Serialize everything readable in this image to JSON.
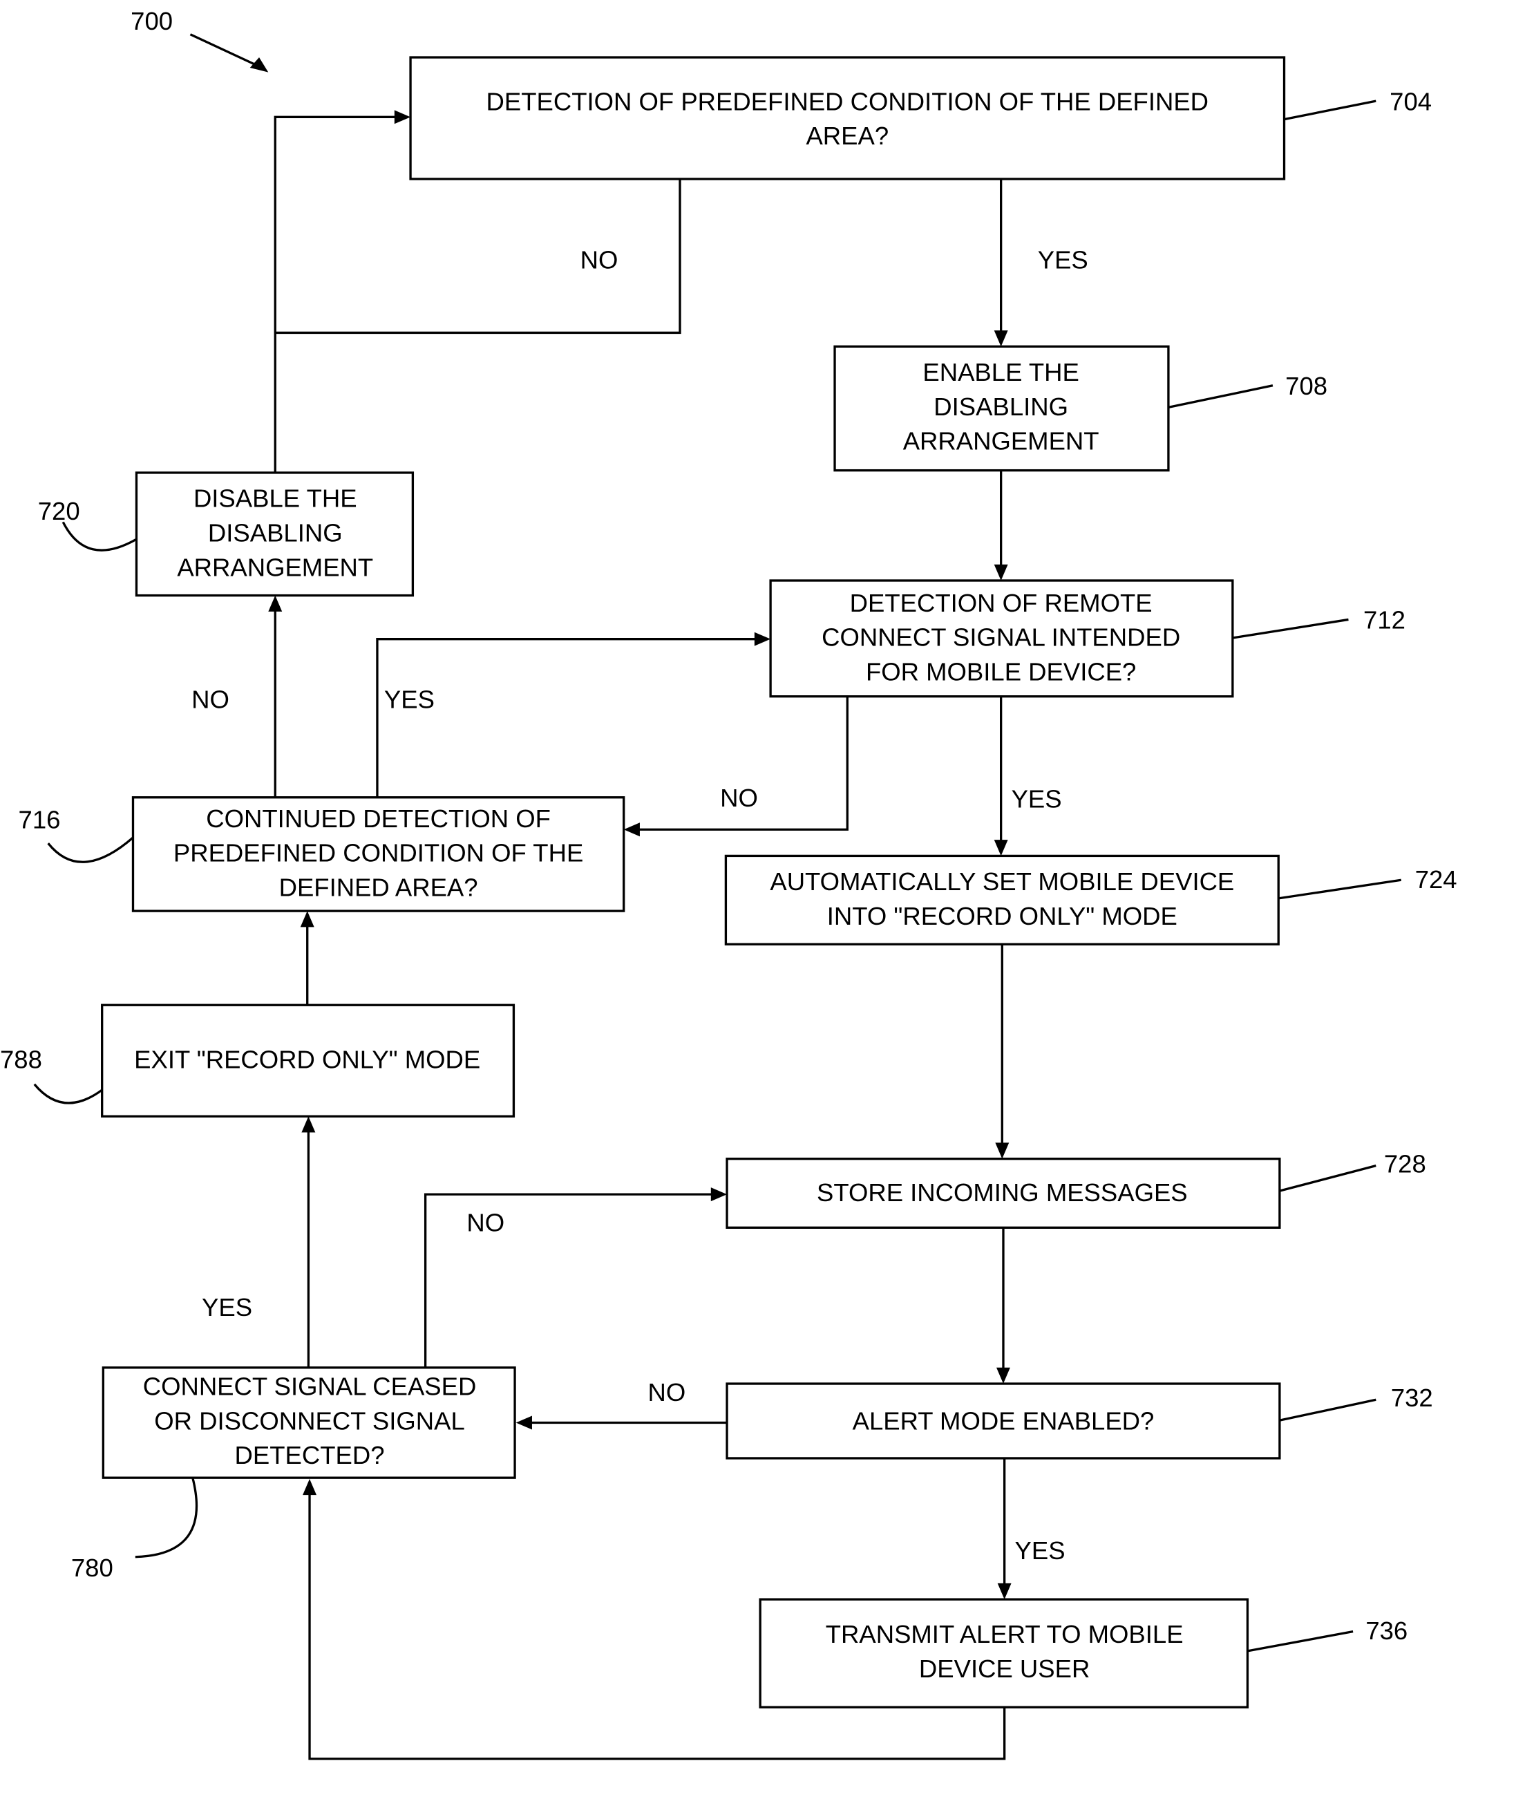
{
  "figure": {
    "ref": "700",
    "nodes": {
      "n704": {
        "ref": "704",
        "lines": [
          "DETECTION OF PREDEFINED CONDITION OF THE DEFINED",
          "AREA?"
        ]
      },
      "n708": {
        "ref": "708",
        "lines": [
          "ENABLE THE",
          "DISABLING",
          "ARRANGEMENT"
        ]
      },
      "n712": {
        "ref": "712",
        "lines": [
          "DETECTION OF REMOTE",
          "CONNECT SIGNAL INTENDED",
          "FOR  MOBILE DEVICE?"
        ]
      },
      "n716": {
        "ref": "716",
        "lines": [
          "CONTINUED DETECTION OF",
          "PREDEFINED CONDITION OF THE",
          "DEFINED AREA?"
        ]
      },
      "n720": {
        "ref": "720",
        "lines": [
          "DISABLE THE",
          "DISABLING",
          "ARRANGEMENT"
        ]
      },
      "n724": {
        "ref": "724",
        "lines": [
          "AUTOMATICALLY SET MOBILE DEVICE",
          "INTO \"RECORD ONLY\" MODE"
        ]
      },
      "n728": {
        "ref": "728",
        "lines": [
          "STORE INCOMING MESSAGES"
        ]
      },
      "n732": {
        "ref": "732",
        "lines": [
          "ALERT MODE ENABLED?"
        ]
      },
      "n736": {
        "ref": "736",
        "lines": [
          "TRANSMIT ALERT TO MOBILE",
          "DEVICE USER"
        ]
      },
      "n780": {
        "ref": "780",
        "lines": [
          "CONNECT SIGNAL CEASED",
          "OR DISCONNECT SIGNAL",
          "DETECTED?"
        ]
      },
      "n788": {
        "ref": "788",
        "lines": [
          "EXIT \"RECORD ONLY\" MODE"
        ]
      }
    },
    "edge_labels": {
      "e704_no": "NO",
      "e704_yes": "YES",
      "e716_no": "NO",
      "e716_yes": "YES",
      "e712_no": "NO",
      "e712_yes": "YES",
      "e780_no": "NO",
      "e780_yes": "YES",
      "e732_no": "NO",
      "e732_yes": "YES"
    }
  }
}
